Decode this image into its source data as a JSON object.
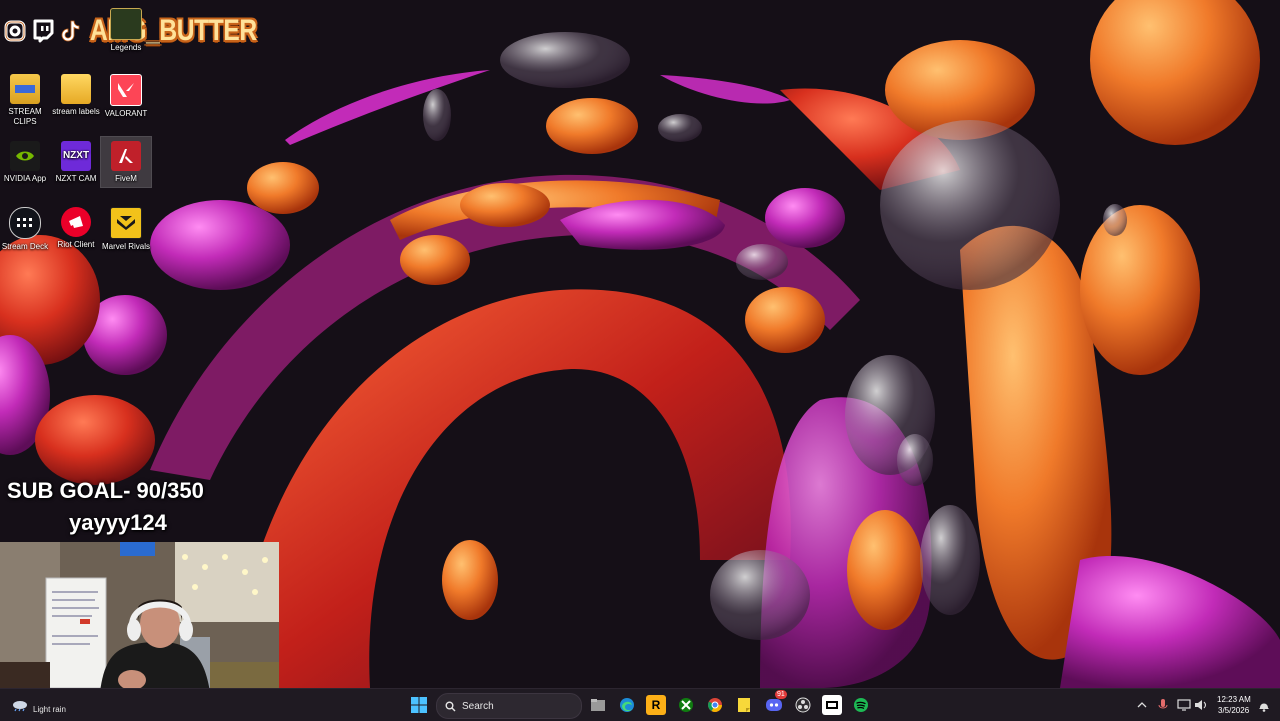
{
  "overlay": {
    "streamer_name": "AMG_BUTTER",
    "sub_goal": "SUB GOAL- 90/350",
    "latest_sub": "yayyy124",
    "socials": [
      "instagram-icon",
      "twitch-icon",
      "tiktok-icon"
    ]
  },
  "desktop": {
    "icons": [
      {
        "label": "Legends"
      },
      {
        "label": "STREAM CLIPS"
      },
      {
        "label": "stream labels"
      },
      {
        "label": "VALORANT"
      },
      {
        "label": "NVIDIA App"
      },
      {
        "label": "NZXT CAM"
      },
      {
        "label": "FiveM"
      },
      {
        "label": "Stream Deck"
      },
      {
        "label": "Riot Client"
      },
      {
        "label": "Marvel Rivals"
      }
    ]
  },
  "taskbar": {
    "weather": "Light rain",
    "search_label": "Search",
    "clock_time": "12:23 AM",
    "clock_date": "3/5/2026",
    "discord_badge": "91",
    "icons": [
      "start-icon",
      "file-explorer-icon",
      "edge-icon",
      "rockstar-icon",
      "xbox-icon",
      "chrome-icon",
      "sticky-notes-icon",
      "discord-icon",
      "obs-icon",
      "capcut-icon",
      "spotify-icon"
    ]
  },
  "colors": {
    "wallpaper_bg": "#150f17",
    "orange": "#f07a2a",
    "magenta": "#c22bb8",
    "red": "#d8301e",
    "taskbar": "#1f1a22",
    "name_fill": "#ffe29a",
    "name_outline": "#c8641a"
  }
}
